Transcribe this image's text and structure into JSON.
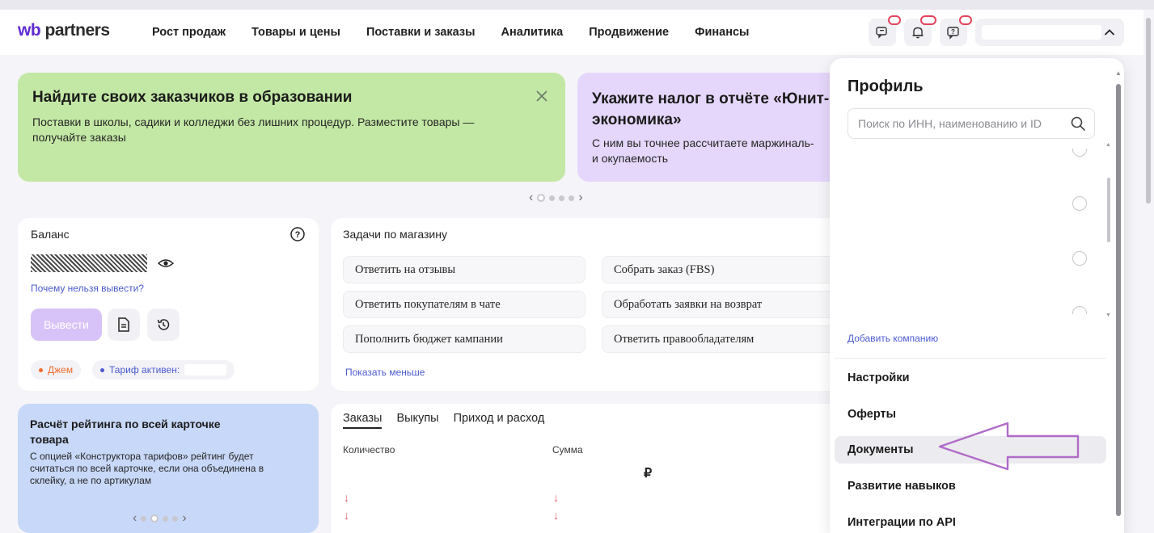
{
  "header": {
    "logo_wb": "wb",
    "logo_rest": " partners",
    "nav": [
      "Рост продаж",
      "Товары и цены",
      "Поставки и заказы",
      "Аналитика",
      "Продвижение",
      "Финансы"
    ]
  },
  "banners": {
    "education": {
      "title": "Найдите своих заказчиков в образовании",
      "text": "Поставки в школы, садики и колледжи без лишних процедур. Разместите товары — получайте заказы"
    },
    "tax": {
      "title": "Укажите налог в отчёте «Юнит-",
      "title2": "экономика»",
      "text": "С ним вы точнее рассчитаете маржиналь-",
      "text2": "и окупаемость"
    }
  },
  "balance": {
    "label": "Баланс",
    "why_link": "Почему нельзя вывести?",
    "withdraw_label": "Вывести",
    "jam_label": "Джем",
    "tariff_label": "Тариф активен:"
  },
  "tasks": {
    "title": "Задачи по магазину",
    "items": [
      "Ответить на отзывы",
      "Собрать заказ (FBS)",
      "Ответить покупателям в чате",
      "Обработать заявки на возврат",
      "Пополнить бюджет кампании",
      "Ответить правообладателям"
    ],
    "show_less": "Показать меньше"
  },
  "rating": {
    "title": "Расчёт рейтинга по всей карточке товара",
    "text": "С опцией «Конструктора тарифов» рейтинг будет считаться по всей карточке, если она объединена в склейку, а не по артикулам"
  },
  "orders": {
    "tabs": [
      "Заказы",
      "Выкупы",
      "Приход и расход"
    ],
    "col_quantity": "Количество",
    "col_sum": "Сумма",
    "currency": "₽",
    "arrow_glyph": "↓"
  },
  "profile": {
    "title": "Профиль",
    "search_placeholder": "Поиск по ИНН, наименованию и ID",
    "search_value": "",
    "add_company": "Добавить компанию",
    "menu": [
      "Настройки",
      "Оферты",
      "Документы",
      "Развитие навыков",
      "Интеграции по API"
    ],
    "highlighted_item": "Документы"
  },
  "colors": {
    "brand_purple": "#5f2bd1",
    "banner_green": "#c3e8a5",
    "banner_violet": "#e5d7fb",
    "banner_blue": "#c7d8f8",
    "link_blue": "#4b5bd1",
    "annotation_arrow": "#b06bc8",
    "badge_red": "#e2445c"
  },
  "icons": {
    "search": "search-icon",
    "chat": "chat-icon",
    "bell": "bell-icon",
    "help_chat": "help-chat-icon",
    "eye": "eye-icon",
    "document": "document-icon",
    "history": "history-icon",
    "help": "question-icon",
    "close": "close-icon",
    "chevron_up": "chevron-up-icon"
  }
}
